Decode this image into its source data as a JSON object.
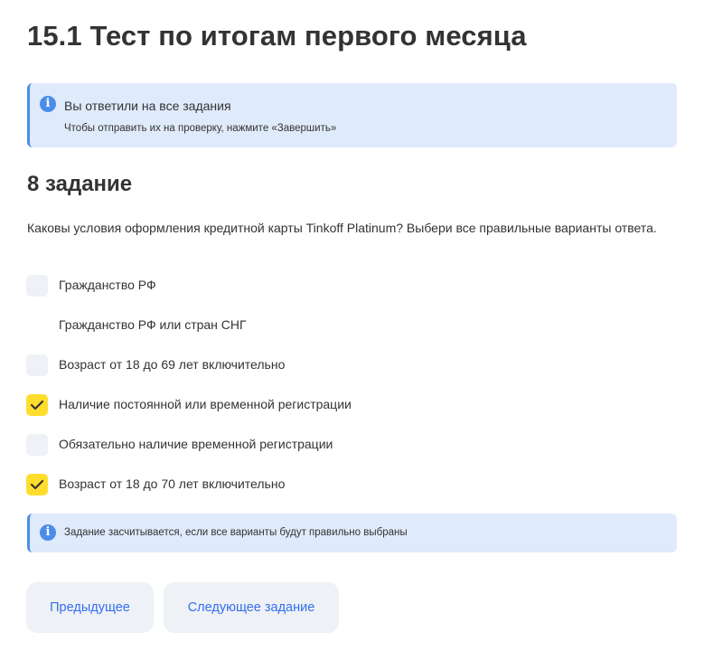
{
  "page": {
    "title": "15.1 Тест по итогам первого месяца"
  },
  "notice_top": {
    "icon": "info-icon",
    "heading": "Вы ответили на все задания",
    "text": "Чтобы отправить их на проверку, нажмите «Завершить»"
  },
  "task": {
    "title": "8 задание",
    "question": "Каковы условия оформления кредитной карты Tinkoff Platinum? Выбери все правильные варианты ответа.",
    "options": [
      {
        "label": "Гражданство РФ",
        "checked": false
      },
      {
        "label": "Гражданство РФ или стран СНГ",
        "checked": false
      },
      {
        "label": "Возраст от 18 до 69 лет включительно",
        "checked": false
      },
      {
        "label": "Наличие постоянной или временной регистрации",
        "checked": true
      },
      {
        "label": "Обязательно наличие временной регистрации",
        "checked": false
      },
      {
        "label": "Возраст от 18 до 70 лет включительно",
        "checked": true
      }
    ]
  },
  "notice_bottom": {
    "icon": "info-icon",
    "text": "Задание засчитывается, если все варианты будут правильно выбраны"
  },
  "buttons": {
    "prev_label": "Предыдущее",
    "next_label": "Следующее задание"
  },
  "colors": {
    "accent_yellow": "#ffdd2d",
    "info_blue": "#4b8de8",
    "notice_bg": "#dfeafb",
    "link_blue": "#336fee",
    "button_bg": "#eef1f6"
  }
}
